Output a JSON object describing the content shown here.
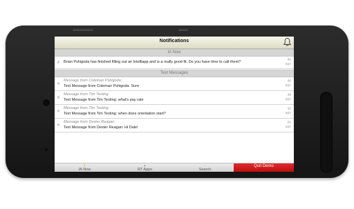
{
  "header": {
    "title": "Notifications"
  },
  "sections": [
    {
      "title": "IA Now"
    },
    {
      "title": "Text Messages"
    }
  ],
  "ia_now": [
    {
      "message": "Brian Pshigoda has finished filling out an Intelliapp and is a really good fit. Do you have time to call them?",
      "time_value": "4d",
      "time_unit": "ago"
    }
  ],
  "text_messages": [
    {
      "from": "Message from Coleman Pshigoda:",
      "text": "Text Message from Coleman Pshigoda: Sure",
      "time_value": "4d",
      "time_unit": "ago"
    },
    {
      "from": "Message from Tim Testing:",
      "text": "Text Message from Tim Testing: what's pay rate",
      "time_value": "4d",
      "time_unit": "ago"
    },
    {
      "from": "Message from Tim Testing:",
      "text": "Text Message from Tim Testing: when does orientation start?",
      "time_value": "3d",
      "time_unit": "ago"
    },
    {
      "from": "Message from Dexter Reagan:",
      "text": "Text Message from Dexter Reagan: Hi Dale!",
      "time_value": "0h",
      "time_unit": "ago"
    }
  ],
  "tabs": [
    {
      "label": "IA Now"
    },
    {
      "label": "RT Apps"
    },
    {
      "label": "Search"
    }
  ],
  "quit_label": "Quit Demo",
  "colors": {
    "quit_button": "#d11a1a",
    "header": "#ecebd8",
    "section": "#d6d6d6"
  }
}
